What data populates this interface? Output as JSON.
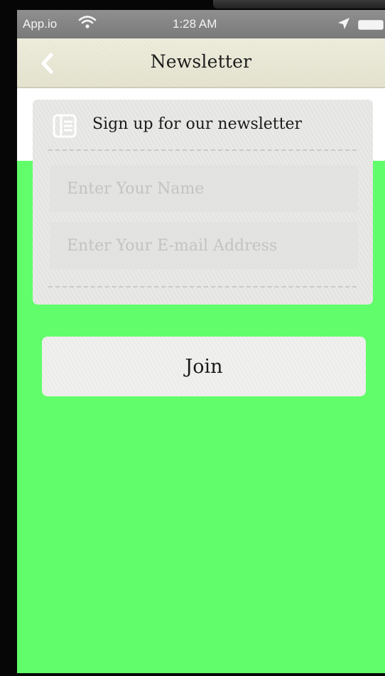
{
  "status_bar": {
    "carrier": "App.io",
    "time": "1:28 AM",
    "wifi_icon": "wifi-icon",
    "location_icon": "location-arrow-icon",
    "battery_icon": "battery-icon"
  },
  "nav": {
    "title": "Newsletter",
    "back_icon": "chevron-left-icon"
  },
  "form": {
    "heading": "Sign up for our newsletter",
    "icon": "newsletter-icon",
    "name_placeholder": "Enter Your Name",
    "email_placeholder": "Enter Your E-mail Address"
  },
  "actions": {
    "join_label": "Join"
  },
  "colors": {
    "background_green": "#61fd6b",
    "nav_background": "#ebead7",
    "card_background": "#e8e8e6"
  }
}
